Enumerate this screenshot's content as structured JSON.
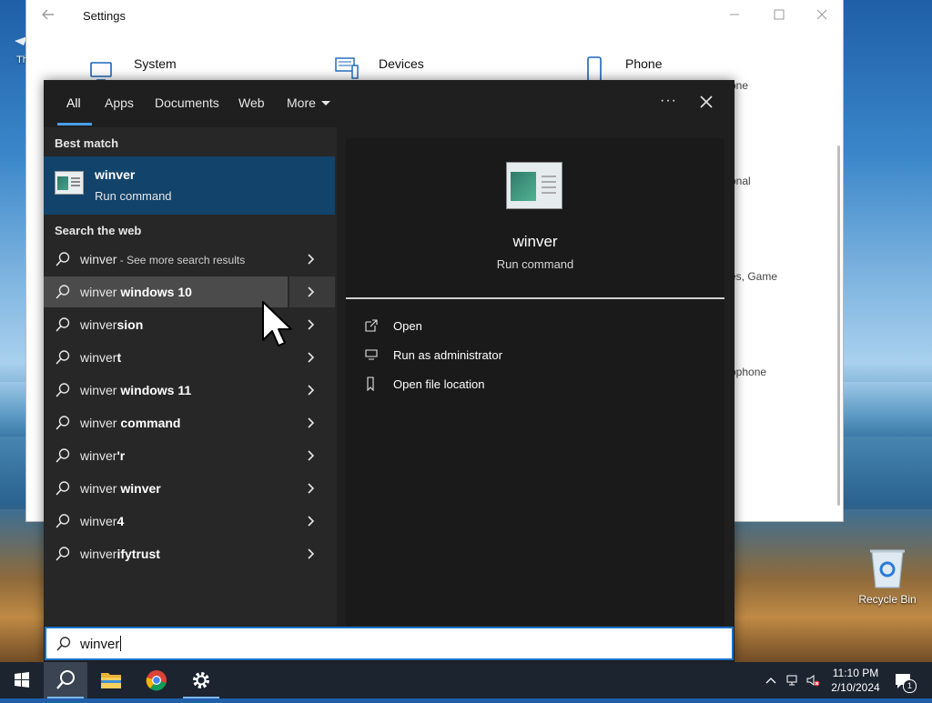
{
  "settings": {
    "title": "Settings",
    "items": [
      "System",
      "Devices",
      "Phone"
    ],
    "partial_texts": [
      "one",
      "onal",
      "es, Game",
      "ophone"
    ]
  },
  "search": {
    "tabs": [
      "All",
      "Apps",
      "Documents",
      "Web",
      "More"
    ],
    "best_match_header": "Best match",
    "best_match": {
      "name": "winver",
      "subtitle": "Run command"
    },
    "web_header": "Search the web",
    "web_results": [
      {
        "prefix": "winver",
        "bold": "",
        "suffix": " - See more search results"
      },
      {
        "prefix": "winver",
        "bold": " windows 10",
        "suffix": ""
      },
      {
        "prefix": "winver",
        "bold": "sion",
        "suffix": ""
      },
      {
        "prefix": "winver",
        "bold": "t",
        "suffix": ""
      },
      {
        "prefix": "winver",
        "bold": " windows 11",
        "suffix": ""
      },
      {
        "prefix": "winver",
        "bold": " command",
        "suffix": ""
      },
      {
        "prefix": "winver",
        "bold": "'r",
        "suffix": ""
      },
      {
        "prefix": "winver",
        "bold": " winver",
        "suffix": ""
      },
      {
        "prefix": "winver",
        "bold": "4",
        "suffix": ""
      },
      {
        "prefix": "winver",
        "bold": "ifytrust",
        "suffix": ""
      }
    ],
    "preview": {
      "name": "winver",
      "subtitle": "Run command",
      "actions": [
        "Open",
        "Run as administrator",
        "Open file location"
      ]
    },
    "query": "winver"
  },
  "desktop": {
    "recycle_bin": "Recycle Bin",
    "partial_left": "Th"
  },
  "taskbar": {
    "time": "11:10 PM",
    "date": "2/10/2024",
    "notification_count": "1",
    "apps": [
      "start-icon",
      "search-icon",
      "file-explorer-icon",
      "chrome-icon",
      "settings-icon"
    ]
  },
  "colors": {
    "accent": "#4a9fe8",
    "best_match_bg": "#12436a",
    "panel_bg": "#1f1f1f"
  }
}
